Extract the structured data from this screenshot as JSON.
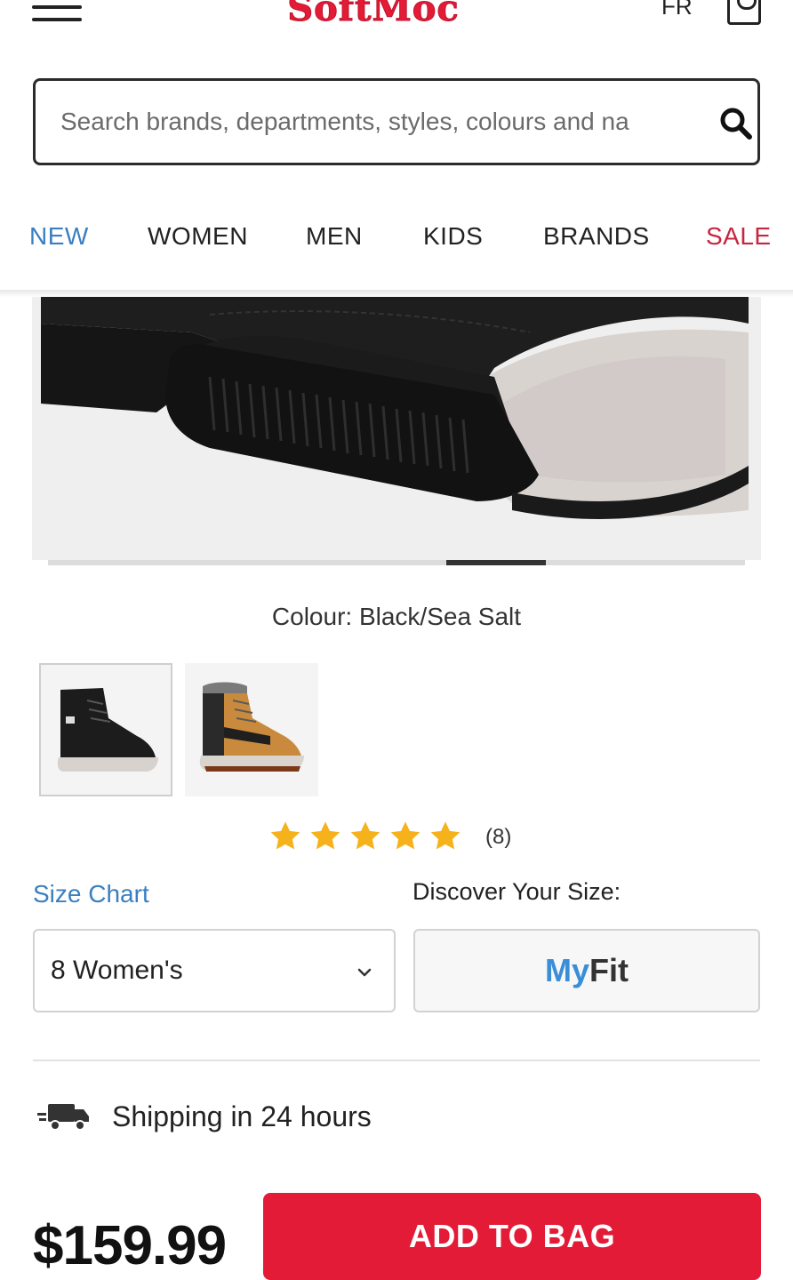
{
  "header": {
    "logo_text": "SoftMoc",
    "lang_label": "FR",
    "search_placeholder": "Search brands, departments, styles, colours and na"
  },
  "nav": {
    "items": [
      {
        "label": "NEW"
      },
      {
        "label": "WOMEN"
      },
      {
        "label": "MEN"
      },
      {
        "label": "KIDS"
      },
      {
        "label": "BRANDS"
      },
      {
        "label": "SALE"
      }
    ]
  },
  "product": {
    "colour_label": "Colour: Black/Sea Salt",
    "swatches": [
      {
        "name": "Black/Sea Salt",
        "selected": true
      },
      {
        "name": "Tan",
        "selected": false
      }
    ],
    "rating": {
      "stars": 5,
      "count_label": "(8)"
    },
    "size_chart_label": "Size Chart",
    "discover_label": "Discover Your Size:",
    "selected_size": "8 Women's",
    "myfit_my": "My",
    "myfit_fit": "Fit",
    "shipping_label": "Shipping in 24 hours",
    "price": "$159.99",
    "add_to_bag_label": "ADD TO BAG"
  },
  "colors": {
    "brand_red": "#e31b37",
    "link_blue": "#3a7fc1",
    "sale_red": "#c7253f",
    "star_gold": "#f5b21b"
  }
}
